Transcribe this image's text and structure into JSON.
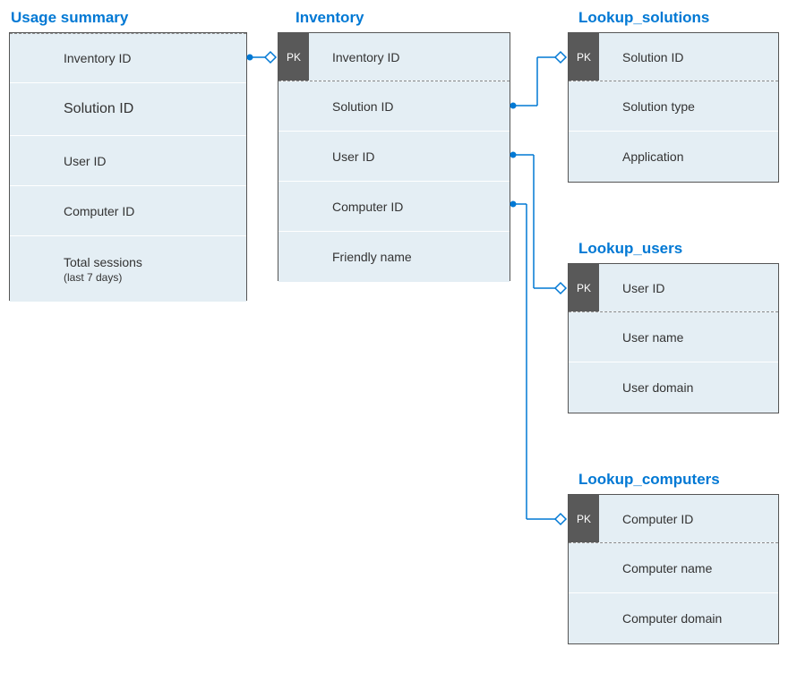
{
  "entities": {
    "usage_summary": {
      "title": "Usage summary",
      "fields": [
        "Inventory ID",
        "Solution ID",
        "User  ID",
        "Computer ID",
        "Total sessions"
      ],
      "field_sub": {
        "4": "(last 7 days)"
      }
    },
    "inventory": {
      "title": "Inventory",
      "pk": "Inventory ID",
      "fields": [
        "Solution ID",
        "User ID",
        "Computer ID",
        "Friendly name"
      ]
    },
    "lookup_solutions": {
      "title": "Lookup_solutions",
      "pk": "Solution ID",
      "fields": [
        "Solution type",
        "Application"
      ]
    },
    "lookup_users": {
      "title": "Lookup_users",
      "pk": "User ID",
      "fields": [
        "User name",
        "User domain"
      ]
    },
    "lookup_computers": {
      "title": "Lookup_computers",
      "pk": "Computer ID",
      "fields": [
        "Computer name",
        "Computer domain"
      ]
    }
  },
  "labels": {
    "pk": "PK"
  }
}
